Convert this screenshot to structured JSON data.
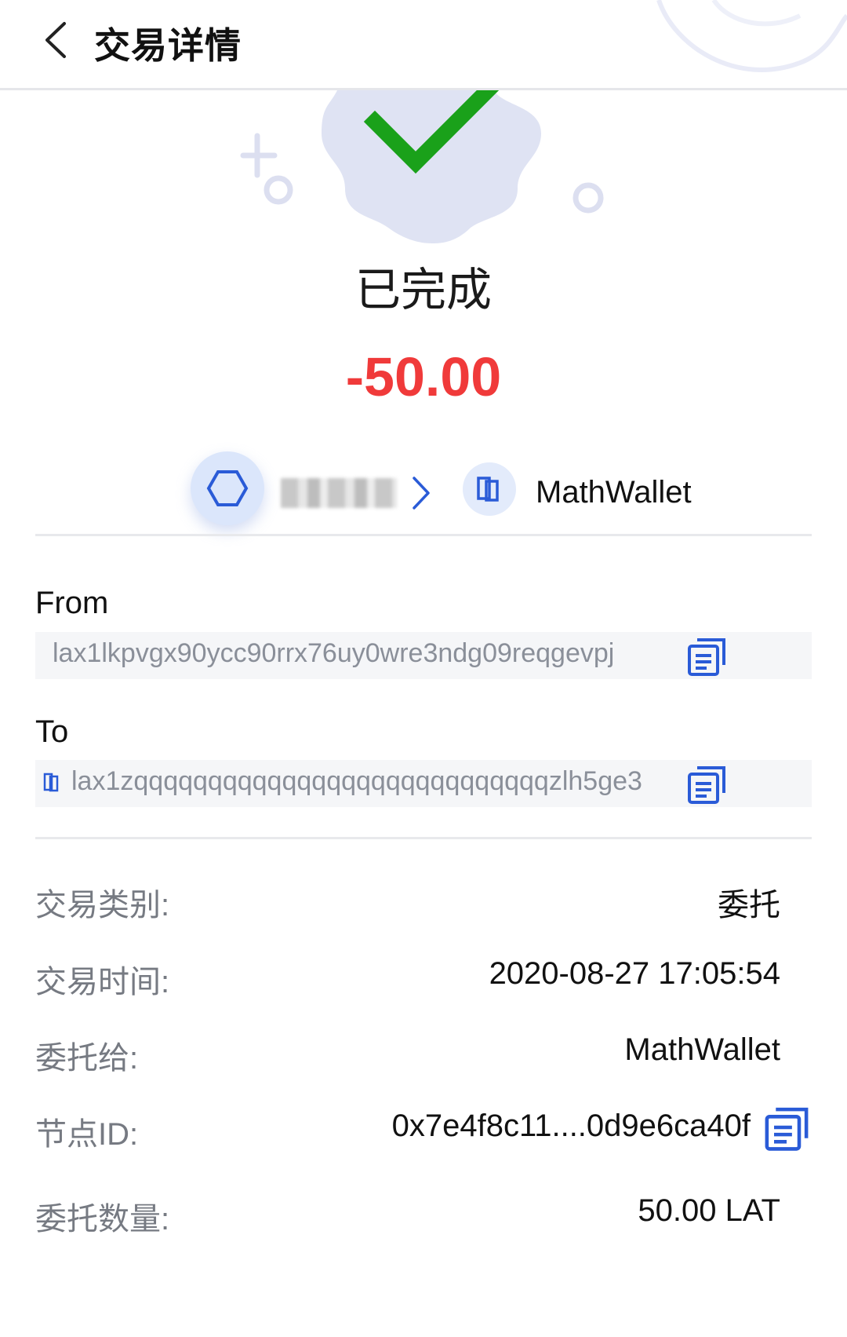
{
  "header": {
    "title": "交易详情"
  },
  "status": {
    "text": "已完成"
  },
  "amount": "-50.00",
  "flow": {
    "to_name": "MathWallet"
  },
  "from": {
    "label": "From",
    "address": "lax1lkpvgx90ycc90rrx76uy0wre3ndg09reqgevpj"
  },
  "to": {
    "label": "To",
    "address": "lax1zqqqqqqqqqqqqqqqqqqqqqqqqqqqqzlh5ge3"
  },
  "details": [
    {
      "label": "交易类别:",
      "value": "委托"
    },
    {
      "label": "交易时间:",
      "value": "2020-08-27 17:05:54"
    },
    {
      "label": "委托给:",
      "value": "MathWallet"
    },
    {
      "label": "节点ID:",
      "value": "0x7e4f8c11....0d9e6ca40f"
    },
    {
      "label": "委托数量:",
      "value": "50.00 LAT"
    }
  ],
  "colors": {
    "success": "#1aa11a",
    "amount": "#f03a3a",
    "accent": "#2a5bd7"
  },
  "icons": [
    "back-arrow-icon",
    "success-check-icon",
    "hexagon-icon",
    "chevron-right-icon",
    "node-icon",
    "copy-icon"
  ]
}
